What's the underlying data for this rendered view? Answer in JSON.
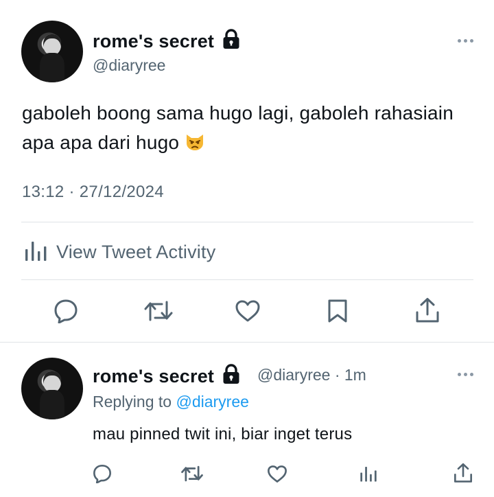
{
  "main_tweet": {
    "author_name": "rome's secret",
    "handle": "@diaryree",
    "text": "gaboleh boong sama hugo lagi, gaboleh rahasiain apa apa dari hugo",
    "emoji": "pouting-cat-emoji",
    "timestamp": "13:12 · 27/12/2024",
    "activity_label": "View Tweet Activity"
  },
  "reply_tweet": {
    "author_name": "rome's secret",
    "handle": "@diaryree",
    "time_ago": "· 1m",
    "replying_prefix": "Replying to",
    "replying_mention": "@diaryree",
    "text": "mau pinned twit ini, biar inget terus"
  },
  "icons": {
    "lock": "lock-icon",
    "more": "more-options-icon",
    "reply": "reply-icon",
    "retweet": "retweet-icon",
    "like": "like-icon",
    "bookmark": "bookmark-icon",
    "share": "share-icon",
    "analytics": "analytics-icon"
  },
  "colors": {
    "text": "#0f1419",
    "secondary": "#536471",
    "link": "#1d9bf0",
    "divider": "#dfe3e6"
  }
}
